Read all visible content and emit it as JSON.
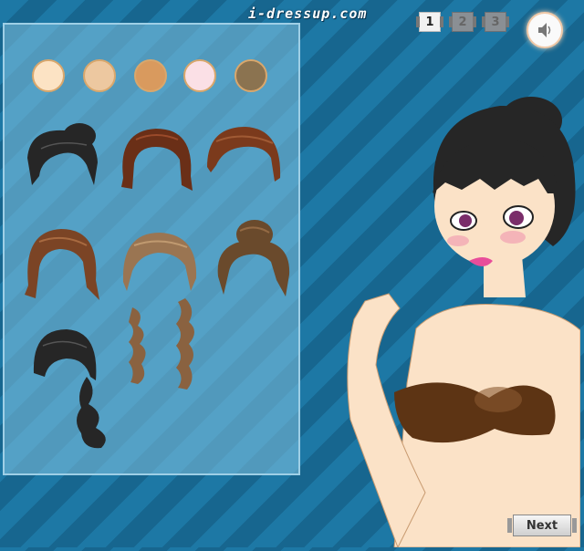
{
  "header": {
    "site_logo": "i-dressup.com",
    "pages": [
      "1",
      "2",
      "3"
    ],
    "active_page": "1",
    "sound_icon": "speaker-icon"
  },
  "skin_tones": [
    "#fce3c4",
    "#edc8a0",
    "#d99a5e",
    "#fbe0e6",
    "#8b7350"
  ],
  "hair_styles": [
    "short-black-updo",
    "auburn-bob",
    "brown-swept",
    "brown-layered",
    "blonde-short",
    "brown-bun",
    "black-side-ponytail",
    "wavy-blonde-pigtails"
  ],
  "hair_colors": {
    "black": "#262626",
    "auburn": "#6a2f17",
    "brown": "#7b4425",
    "light_brown": "#9a7552",
    "dark_brown": "#6a4a2c"
  },
  "model": {
    "skin": "#fbe2c7",
    "hair": "#262626",
    "top": "#5d3414"
  },
  "footer": {
    "next_label": "Next"
  }
}
